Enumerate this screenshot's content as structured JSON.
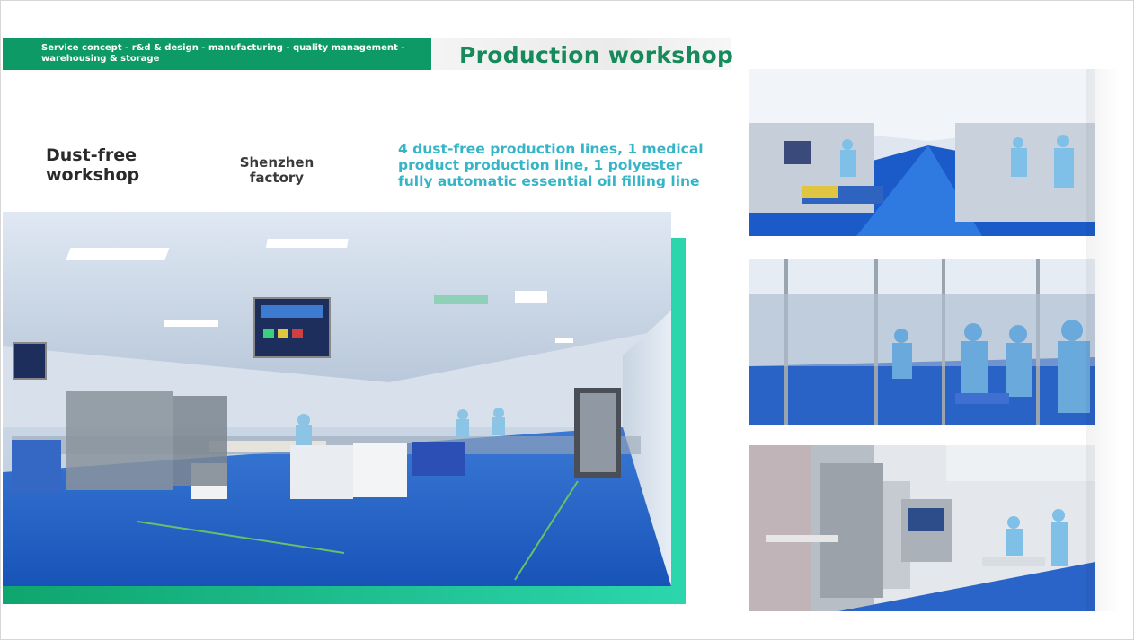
{
  "header": {
    "band_text": "Service concept - r&d & design - manufacturing - quality management - warehousing & storage",
    "title": "Production workshop"
  },
  "labels": {
    "dust_free": "Dust-free workshop",
    "factory": "Shenzhen factory",
    "description": "4 dust-free production lines, 1 medical product production line, 1 polyester fully automatic essential oil filling line"
  },
  "colors": {
    "band_green": "#0d9a66",
    "title_green": "#168a5a",
    "description_teal": "#35b5c7",
    "frame_start": "#0fa56e",
    "frame_end": "#2cd6ad"
  }
}
